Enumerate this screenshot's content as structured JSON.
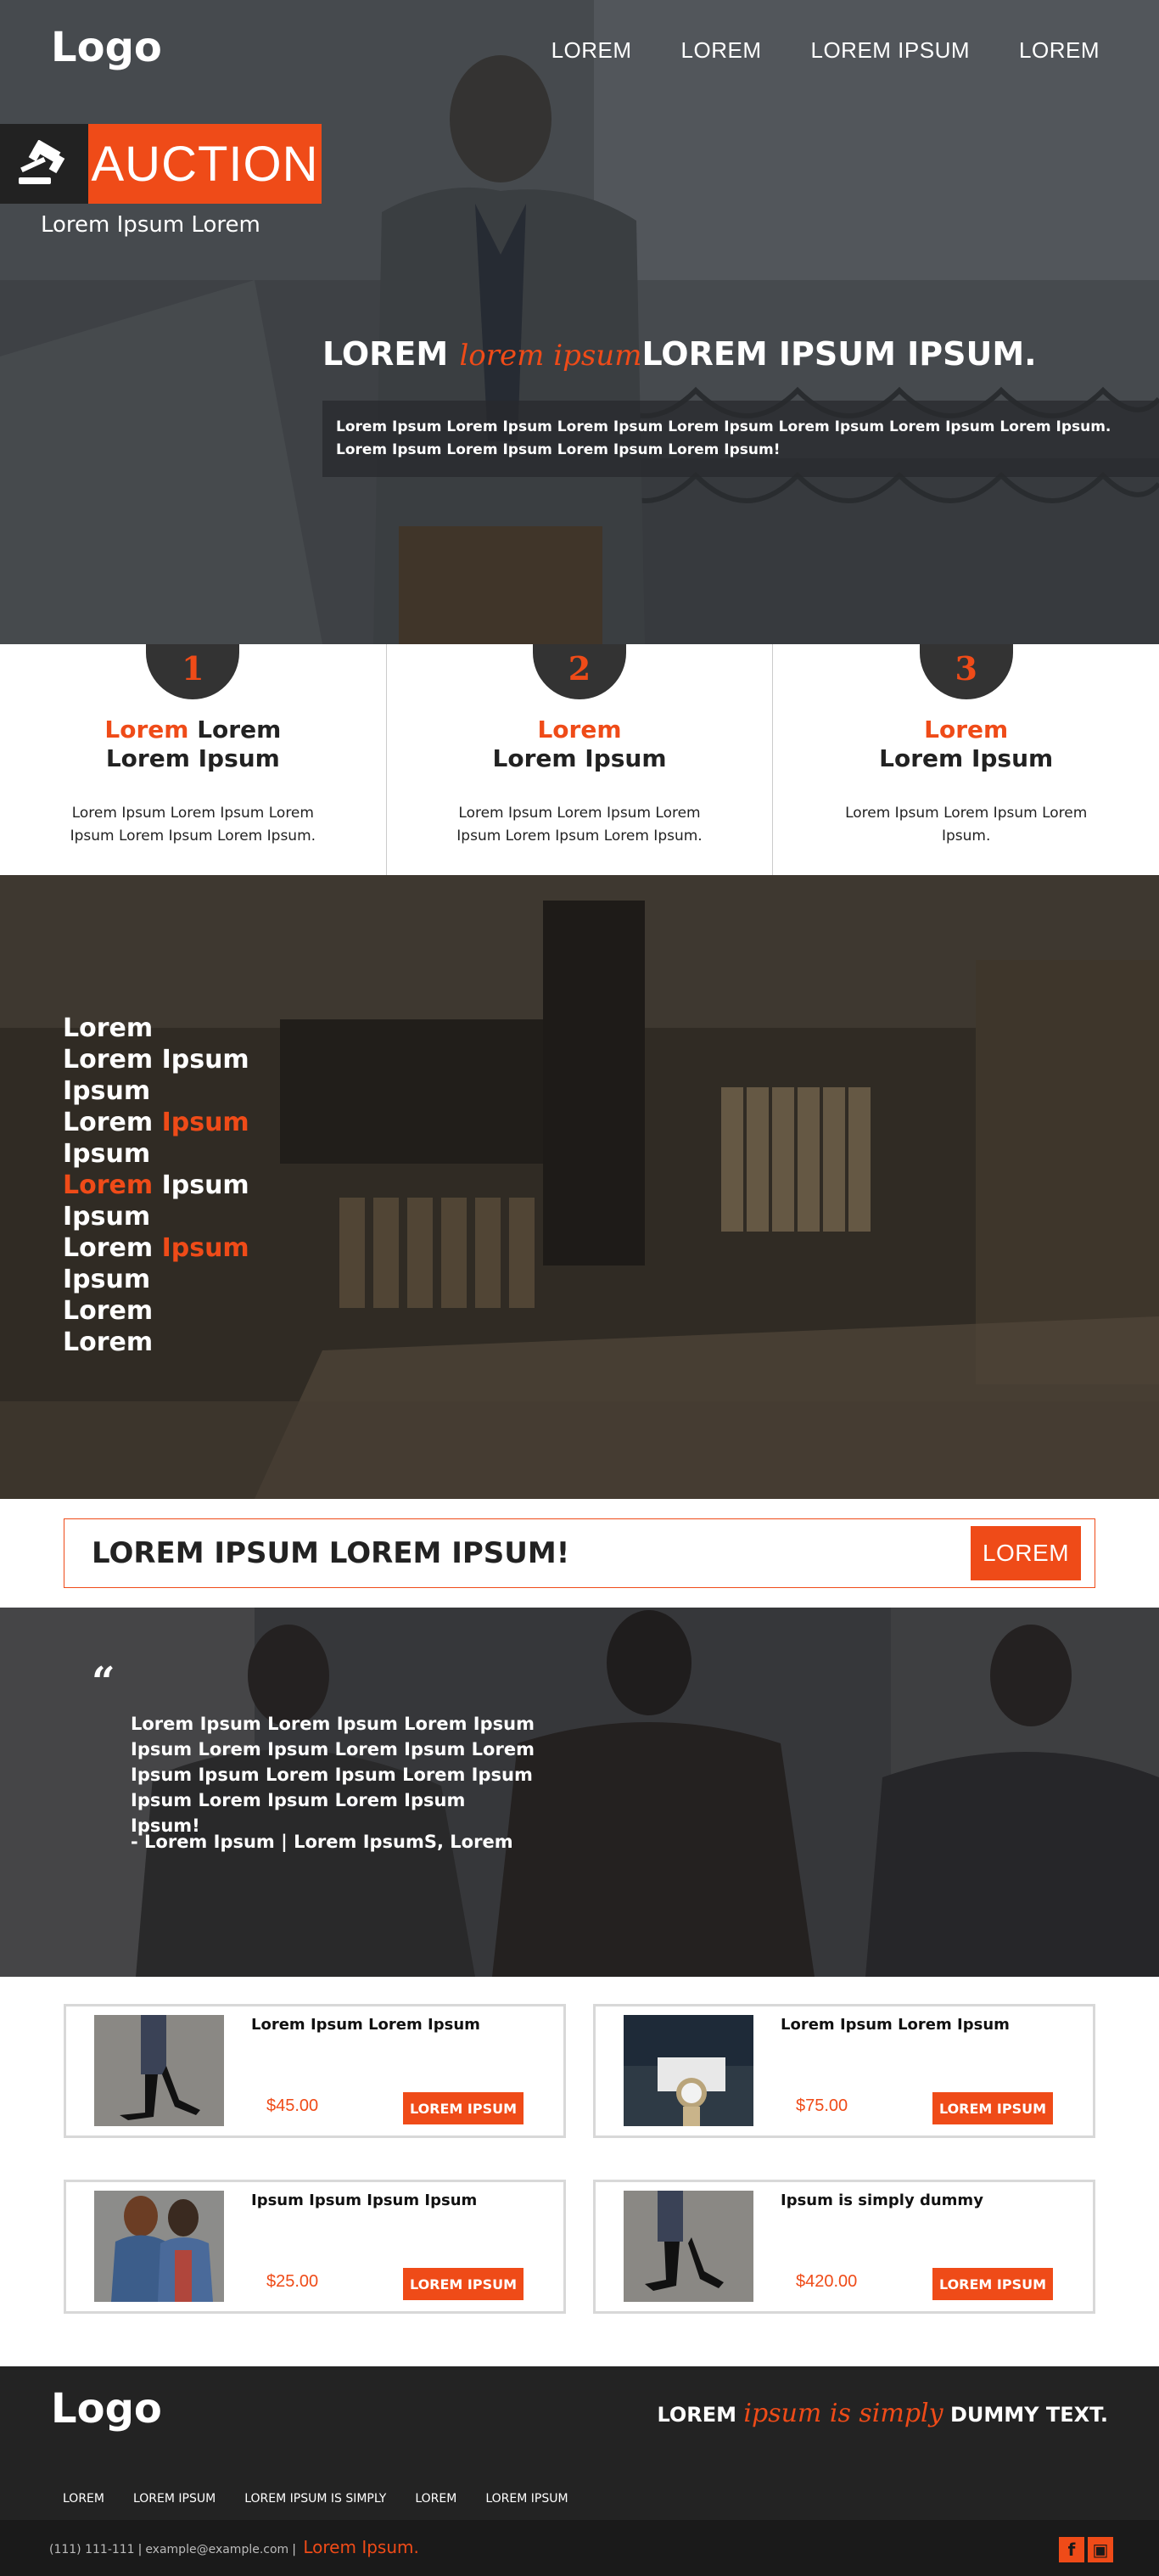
{
  "header": {
    "logo": "Logo",
    "nav": [
      "LOREM",
      "LOREM",
      "LOREM IPSUM",
      "LOREM"
    ]
  },
  "hero": {
    "badge_icon": "gavel-icon",
    "badge_label": "AUCTION",
    "badge_subtitle": "Lorem Ipsum Lorem",
    "heading_part1": "LOREM ",
    "heading_script": "lorem ipsum",
    "heading_part2": "LOREM IPSUM IPSUM.",
    "description": "Lorem Ipsum Lorem Ipsum Lorem Ipsum Lorem Ipsum Lorem Ipsum Lorem Ipsum Lorem Ipsum. Lorem Ipsum Lorem Ipsum Lorem Ipsum Lorem Ipsum!"
  },
  "steps": [
    {
      "number": "1",
      "title_accent": "Lorem",
      "title_rest": " Lorem",
      "title_line2": "Lorem Ipsum",
      "text": "Lorem Ipsum Lorem Ipsum Lorem Ipsum Lorem Ipsum Lorem Ipsum."
    },
    {
      "number": "2",
      "title_accent": "Lorem",
      "title_rest": "",
      "title_line2": "Lorem Ipsum",
      "text": "Lorem Ipsum Lorem Ipsum Lorem Ipsum Lorem Ipsum Lorem Ipsum."
    },
    {
      "number": "3",
      "title_accent": "Lorem",
      "title_rest": "",
      "title_line2": "Lorem Ipsum",
      "text": "Lorem Ipsum Lorem Ipsum Lorem Ipsum."
    }
  ],
  "store": {
    "lines": [
      [
        {
          "t": "Lorem",
          "o": false
        }
      ],
      [
        {
          "t": "Lorem Ipsum",
          "o": false
        }
      ],
      [
        {
          "t": "Ipsum",
          "o": false
        }
      ],
      [
        {
          "t": "Lorem ",
          "o": false
        },
        {
          "t": "Ipsum",
          "o": true
        }
      ],
      [
        {
          "t": "Ipsum",
          "o": false
        }
      ],
      [
        {
          "t": "Lorem",
          "o": true
        },
        {
          "t": " Ipsum",
          "o": false
        }
      ],
      [
        {
          "t": "Ipsum",
          "o": false
        }
      ],
      [
        {
          "t": "Lorem ",
          "o": false
        },
        {
          "t": "Ipsum",
          "o": true
        }
      ],
      [
        {
          "t": "Ipsum",
          "o": false
        }
      ],
      [
        {
          "t": "Lorem",
          "o": false
        }
      ],
      [
        {
          "t": "Lorem",
          "o": false
        }
      ]
    ]
  },
  "cta": {
    "text": "LOREM IPSUM LOREM IPSUM!",
    "button": "LOREM"
  },
  "testimonial": {
    "quote_mark": "“",
    "text": "Lorem Ipsum Lorem Ipsum Lorem Ipsum Ipsum Lorem Ipsum Lorem Ipsum Lorem Ipsum Ipsum Lorem Ipsum Lorem Ipsum Ipsum Lorem Ipsum Lorem Ipsum Ipsum!",
    "author": "- Lorem Ipsum | Lorem IpsumS, Lorem"
  },
  "products": [
    {
      "name": "Lorem Ipsum Lorem Ipsum",
      "price": "$45.00",
      "button": "LOREM IPSUM",
      "image": "heels-photo"
    },
    {
      "name": "Lorem Ipsum Lorem Ipsum",
      "price": "$75.00",
      "button": "LOREM IPSUM",
      "image": "watch-photo"
    },
    {
      "name": "Ipsum Ipsum Ipsum Ipsum",
      "price": "$25.00",
      "button": "LOREM IPSUM",
      "image": "couple-photo"
    },
    {
      "name": "Ipsum is simply dummy",
      "price": "$420.00",
      "button": "LOREM IPSUM",
      "image": "heels-photo"
    }
  ],
  "footer": {
    "logo": "Logo",
    "tag_part1": "LOREM ",
    "tag_script": "ipsum is simply",
    "tag_part2": " DUMMY TEXT.",
    "nav": [
      "LOREM",
      "LOREM IPSUM",
      "LOREM IPSUM IS SIMPLY",
      "LOREM",
      "LOREM IPSUM"
    ],
    "phone": "(111) 111-111",
    "email": "example@example.com",
    "brand": "Lorem Ipsum.",
    "social": [
      "f",
      "▣"
    ]
  },
  "colors": {
    "accent": "#ef4b18",
    "dark": "#232323"
  }
}
